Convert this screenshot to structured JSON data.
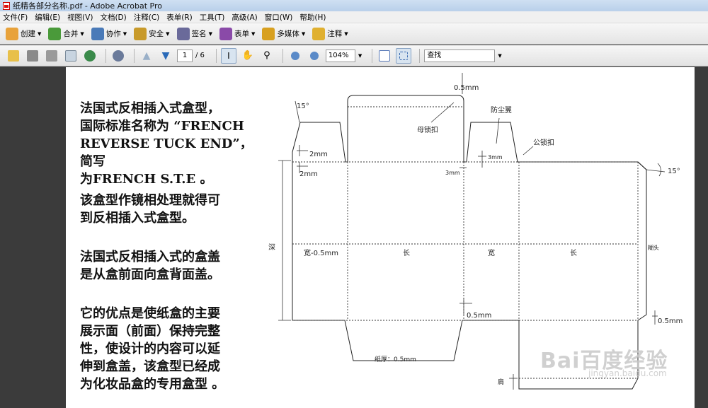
{
  "window": {
    "title": "纸精各部分名称.pdf - Adobe Acrobat Pro"
  },
  "menu": [
    "文件(F)",
    "编辑(E)",
    "视图(V)",
    "文档(D)",
    "注释(C)",
    "表单(R)",
    "工具(T)",
    "高级(A)",
    "窗口(W)",
    "帮助(H)"
  ],
  "toolbar1": [
    {
      "label": "创建",
      "icon": "create-icon",
      "color": "#e8a23a"
    },
    {
      "label": "合并",
      "icon": "combine-icon",
      "color": "#4a9a3a"
    },
    {
      "label": "协作",
      "icon": "collaborate-icon",
      "color": "#4a7ab8"
    },
    {
      "label": "安全",
      "icon": "lock-icon",
      "color": "#c89a2a"
    },
    {
      "label": "签名",
      "icon": "pen-icon",
      "color": "#6a6a9a"
    },
    {
      "label": "表单",
      "icon": "form-icon",
      "color": "#8a4aa8"
    },
    {
      "label": "多媒体",
      "icon": "multimedia-icon",
      "color": "#d8a020"
    },
    {
      "label": "注释",
      "icon": "comment-icon",
      "color": "#e0b030"
    }
  ],
  "toolbar2": {
    "page_current": "1",
    "page_total": "/ 6",
    "zoom": "104%",
    "find_placeholder": "查找"
  },
  "document": {
    "paragraphs": [
      [
        "法国式反相插入式盒型，",
        "国际标准名称为 “FRENCH",
        "REVERSE TUCK END”，简写",
        "为FRENCH S.T.E 。"
      ],
      [
        "该盒型作镜相处理就得可",
        "到反相插入式盒型。"
      ],
      [
        "法国式反相插入式的盒盖",
        "是从盒前面向盒背面盖。"
      ],
      [
        "它的优点是使纸盒的主要",
        "展示面（前面）保持完整",
        "性，使设计的内容可以延",
        "伸到盒盖，该盒型已经成",
        "为化妆品盒的专用盒型 。"
      ]
    ],
    "diagram_labels": {
      "angle_top": "15°",
      "angle_right": "15°",
      "top_gap": "0.5mm",
      "female_lock": "母锁扣",
      "dust_flap": "防尘翼",
      "male_lock": "公锁扣",
      "dim_2mm_a": "2mm",
      "dim_2mm_b": "2mm",
      "dim_3mm_a": "3mm",
      "dim_3mm_b": "3mm",
      "depth": "深",
      "width_minus": "宽-0.5mm",
      "length1": "长",
      "width": "宽",
      "length2": "长",
      "glue_flap": "糊头",
      "mid_gap": "0.5mm",
      "right_gap": "0.5mm",
      "thickness": "纸厚：0.5mm",
      "shoulder": "肩"
    },
    "watermark": {
      "main": "Bai百度经验",
      "sub": "jingyan.baidu.com"
    }
  }
}
